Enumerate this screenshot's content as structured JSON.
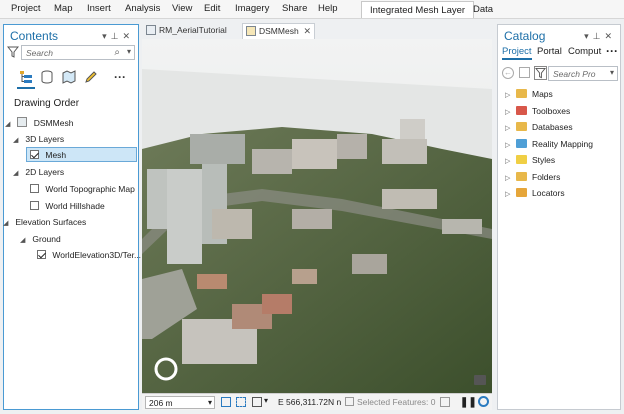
{
  "ribbon": {
    "menu": [
      "Project",
      "Map",
      "Insert",
      "Analysis",
      "View",
      "Edit",
      "Imagery",
      "Share",
      "Help"
    ],
    "context_tabs": [
      "Integrated Mesh Layer",
      "Data"
    ]
  },
  "contents": {
    "title": "Contents",
    "search_placeholder": "Search",
    "section_label": "Drawing Order",
    "map_name": "DSMMesh",
    "groups": {
      "layers_3d": "3D Layers",
      "mesh": "Mesh",
      "layers_2d": "2D Layers",
      "topo": "World Topographic Map",
      "hillshade": "World Hillshade",
      "elevation": "Elevation Surfaces",
      "ground": "Ground",
      "world_elev": "WorldElevation3D/Ter..."
    }
  },
  "doc_tabs": [
    "RM_AerialTutorial",
    "DSMMesh"
  ],
  "statusbar": {
    "scale": "206 m",
    "coordinate": "E 566,311.72N n",
    "selected_features": "Selected Features: 0"
  },
  "catalog": {
    "title": "Catalog",
    "tabs": [
      "Project",
      "Portal",
      "Comput"
    ],
    "search_placeholder": "Search Pro",
    "items": [
      "Maps",
      "Toolboxes",
      "Databases",
      "Reality Mapping",
      "Styles",
      "Folders",
      "Locators"
    ]
  },
  "colors": {
    "accent": "#1d6fa8",
    "selection": "#cde6f7",
    "active_border": "#4a9ad3"
  }
}
